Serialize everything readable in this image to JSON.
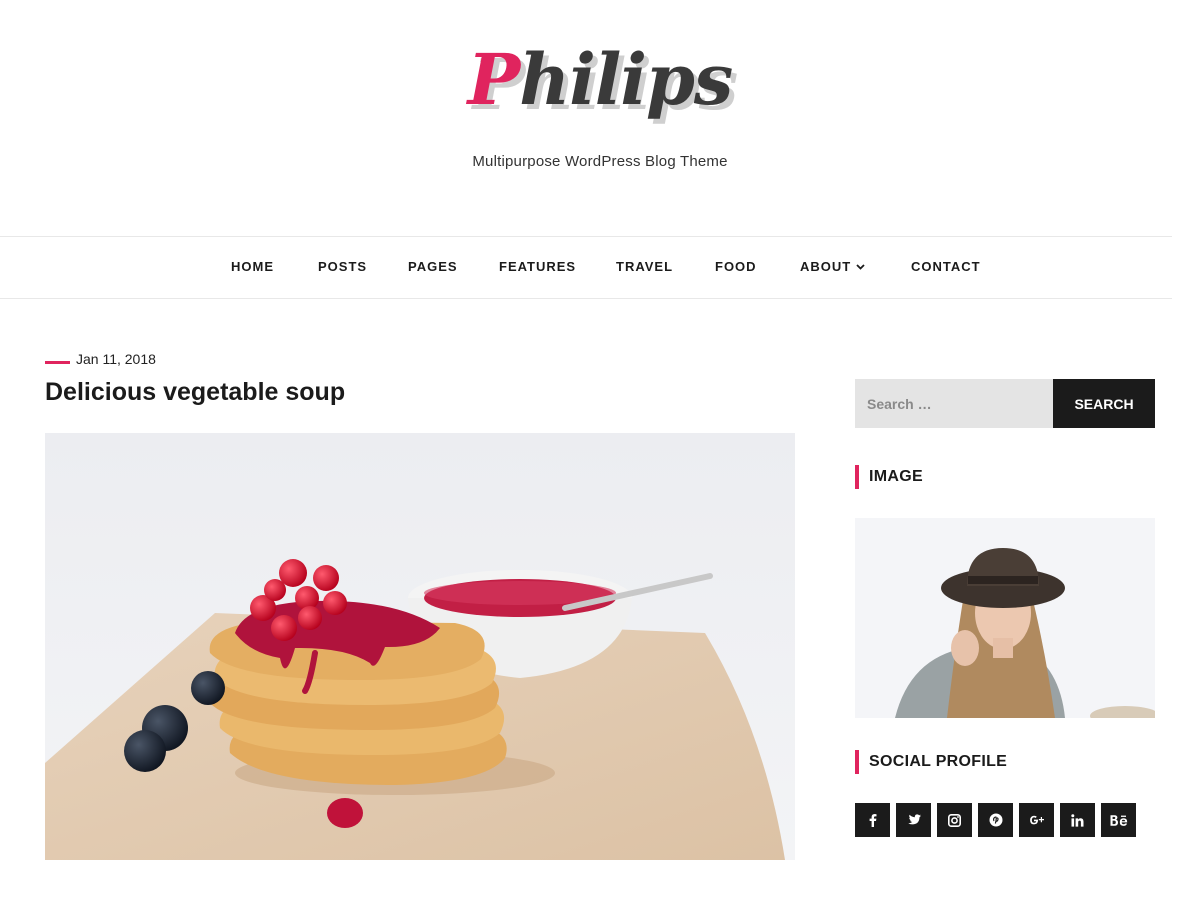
{
  "header": {
    "logo_first": "P",
    "logo_rest": "hilips",
    "tagline": "Multipurpose WordPress Blog Theme"
  },
  "nav": {
    "items": [
      {
        "label": "HOME"
      },
      {
        "label": "POSTS"
      },
      {
        "label": "PAGES"
      },
      {
        "label": "FEATURES"
      },
      {
        "label": "TRAVEL"
      },
      {
        "label": "FOOD"
      },
      {
        "label": "ABOUT",
        "icon": "chevron-down-icon"
      },
      {
        "label": "CONTACT"
      }
    ]
  },
  "post": {
    "date": "Jan 11, 2018",
    "title": "Delicious vegetable soup",
    "image": "waffle-stack-photo"
  },
  "sidebar": {
    "search": {
      "placeholder": "Search …",
      "button_label": "SEARCH"
    },
    "image_widget": {
      "title": "IMAGE",
      "image": "woman-in-hat-photo"
    },
    "social_widget": {
      "title": "SOCIAL PROFILE",
      "icons": [
        "facebook-icon",
        "twitter-icon",
        "instagram-icon",
        "pinterest-icon",
        "google-plus-icon",
        "linkedin-icon",
        "behance-icon"
      ]
    }
  },
  "colors": {
    "accent": "#e0245e",
    "dark": "#1b1b1b",
    "search_bg": "#e4e4e4"
  }
}
